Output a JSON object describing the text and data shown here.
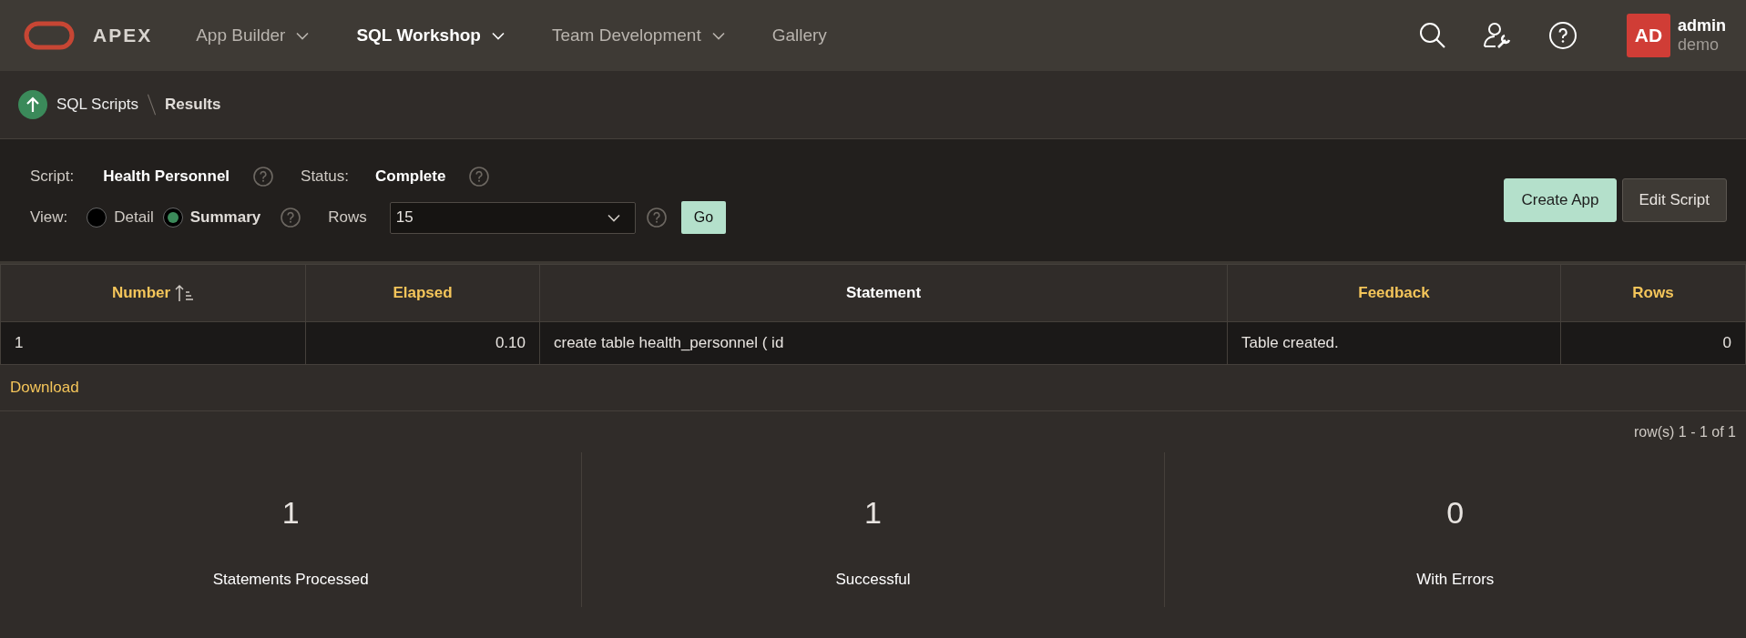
{
  "header": {
    "logo_text": "APEX",
    "nav": [
      {
        "label": "App Builder",
        "selected": false,
        "dropdown": true
      },
      {
        "label": "SQL Workshop",
        "selected": true,
        "dropdown": true
      },
      {
        "label": "Team Development",
        "selected": false,
        "dropdown": true
      },
      {
        "label": "Gallery",
        "selected": false,
        "dropdown": false
      }
    ],
    "user": {
      "initials": "AD",
      "name": "admin",
      "workspace": "demo"
    }
  },
  "breadcrumb": {
    "parent": "SQL Scripts",
    "current": "Results"
  },
  "form": {
    "script_label": "Script:",
    "script_value": "Health Personnel",
    "status_label": "Status:",
    "status_value": "Complete",
    "view_label": "View:",
    "view_options": [
      {
        "label": "Detail",
        "selected": false
      },
      {
        "label": "Summary",
        "selected": true
      }
    ],
    "rows_label": "Rows",
    "rows_value": "15",
    "go_button": "Go",
    "buttons": [
      {
        "label": "Create App",
        "kind": "primary"
      },
      {
        "label": "Edit Script",
        "kind": "secondary"
      }
    ]
  },
  "table": {
    "columns": [
      {
        "label": "Number",
        "sortable": true,
        "sorted": true,
        "kind": "text"
      },
      {
        "label": "Elapsed",
        "sortable": true,
        "sorted": false,
        "kind": "number"
      },
      {
        "label": "Statement",
        "sortable": false,
        "sorted": false,
        "kind": "text"
      },
      {
        "label": "Feedback",
        "sortable": true,
        "sorted": false,
        "kind": "text"
      },
      {
        "label": "Rows",
        "sortable": true,
        "sorted": false,
        "kind": "number"
      }
    ],
    "rows": [
      [
        "1",
        "0.10",
        "create table health_personnel ( id",
        "Table created.",
        "0"
      ]
    ],
    "download": "Download",
    "pagination": "row(s) 1 - 1 of 1"
  },
  "stats": [
    {
      "value": "1",
      "label": "Statements Processed"
    },
    {
      "value": "1",
      "label": "Successful"
    },
    {
      "value": "0",
      "label": "With Errors"
    }
  ]
}
